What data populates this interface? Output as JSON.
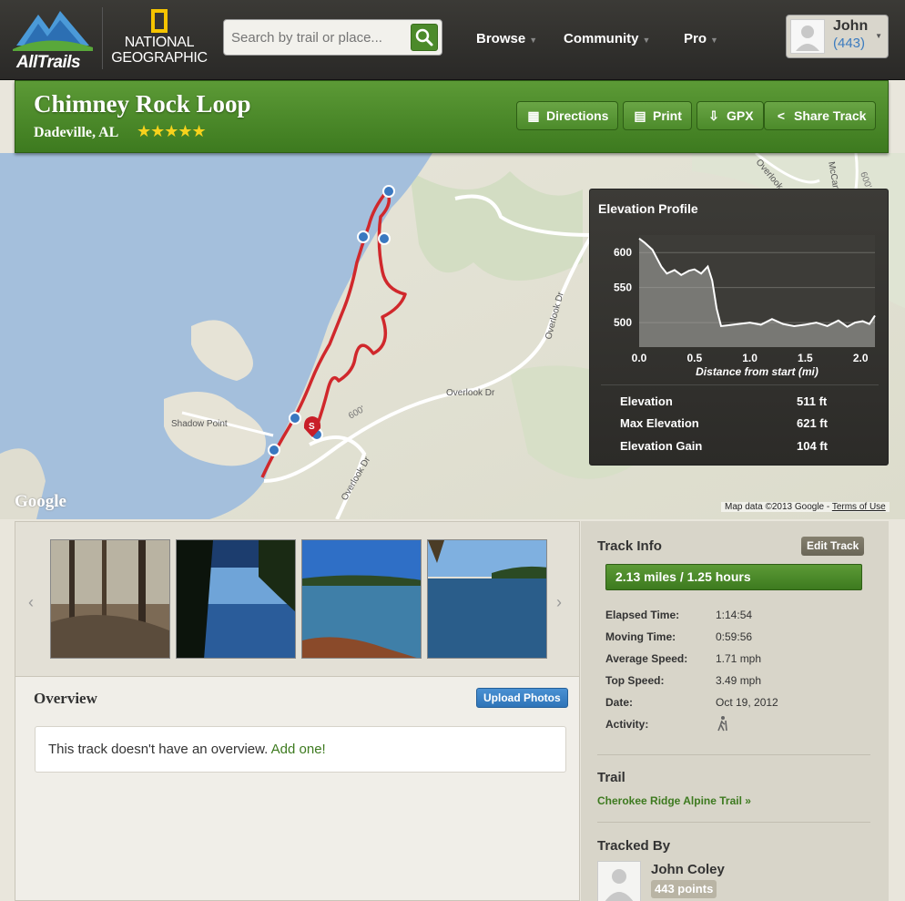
{
  "header": {
    "brand": "AllTrails",
    "partner_line1": "NATIONAL",
    "partner_line2": "GEOGRAPHIC",
    "search_placeholder": "Search by trail or place...",
    "nav": [
      "Browse",
      "Community",
      "Pro"
    ],
    "user_name": "John",
    "user_points": "(443)"
  },
  "trail": {
    "title": "Chimney Rock Loop",
    "location": "Dadeville, AL",
    "stars": "★★★★★",
    "buttons": [
      "Directions",
      "Print",
      "GPX",
      "Share Track"
    ]
  },
  "map": {
    "attribution": "Map data ©2013 Google - ",
    "terms": "Terms of Use",
    "google_logo": "Google",
    "labels": [
      "Shadow Point",
      "Overlook Dr",
      "Overlook Dr",
      "Overlook Dr",
      "Overlook Dr",
      "McCarty",
      "600'",
      "600'"
    ],
    "start_marker": "S"
  },
  "elevation": {
    "title": "Elevation Profile",
    "stats": [
      {
        "label": "Elevation",
        "value": "511 ft"
      },
      {
        "label": "Max Elevation",
        "value": "621 ft"
      },
      {
        "label": "Elevation Gain",
        "value": "104 ft"
      }
    ]
  },
  "chart_data": {
    "type": "area",
    "xlabel": "Distance from start (mi)",
    "ylabel": "",
    "x_ticks": [
      "0.0",
      "0.5",
      "1.0",
      "1.5",
      "2.0"
    ],
    "y_ticks": [
      "600",
      "550",
      "500"
    ],
    "xlim": [
      0,
      2.13
    ],
    "ylim": [
      465,
      625
    ],
    "grid": true,
    "x": [
      0,
      0.05,
      0.12,
      0.2,
      0.25,
      0.32,
      0.38,
      0.45,
      0.5,
      0.56,
      0.62,
      0.66,
      0.7,
      0.74,
      0.8,
      0.9,
      1.0,
      1.1,
      1.2,
      1.3,
      1.4,
      1.5,
      1.6,
      1.7,
      1.8,
      1.88,
      1.95,
      2.02,
      2.08,
      2.13
    ],
    "y": [
      620,
      614,
      604,
      580,
      570,
      575,
      568,
      574,
      576,
      570,
      580,
      560,
      520,
      495,
      496,
      498,
      500,
      497,
      505,
      498,
      495,
      497,
      500,
      495,
      503,
      494,
      500,
      502,
      498,
      510
    ]
  },
  "gallery": {
    "prev": "‹",
    "next": "›"
  },
  "overview": {
    "title": "Overview",
    "upload": "Upload Photos",
    "empty_text": "This track doesn't have an overview. ",
    "add_link": "Add one!"
  },
  "track_info": {
    "title": "Track Info",
    "edit": "Edit Track",
    "distance_time": "2.13 miles / 1.25 hours",
    "rows": [
      {
        "label": "Elapsed Time:",
        "value": "1:14:54"
      },
      {
        "label": "Moving Time:",
        "value": "0:59:56"
      },
      {
        "label": "Average Speed:",
        "value": "1.71 mph"
      },
      {
        "label": "Top Speed:",
        "value": "3.49 mph"
      },
      {
        "label": "Date:",
        "value": "Oct 19, 2012"
      },
      {
        "label": "Activity:",
        "value": ""
      }
    ],
    "trail_heading": "Trail",
    "trail_link": "Cherokee Ridge Alpine Trail »",
    "tracked_by_heading": "Tracked By",
    "tracker_name": "John Coley",
    "tracker_points": "443 points"
  },
  "colors": {
    "brand_green": "#4c8a2a",
    "route_red": "#d0282c",
    "water_blue": "#a4bfdc",
    "link_blue": "#3b7bbf"
  }
}
